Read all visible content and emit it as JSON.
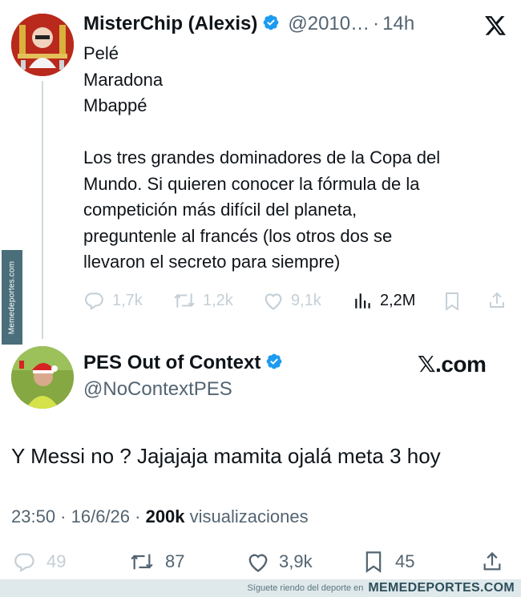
{
  "quoted_tweet": {
    "display_name": "MisterChip (Alexis)",
    "handle": "@2010…",
    "separator": "·",
    "time": "14h",
    "lines": [
      "Pelé",
      "Maradona",
      "Mbappé"
    ],
    "paragraph_lines": [
      "Los tres grandes dominadores de la Copa del",
      "Mundo. Si quieren conocer la fórmula de la",
      "competición más difícil del planeta,",
      "preguntenle al francés (los otros dos se",
      "llevaron el secreto para siempre)"
    ],
    "stats": {
      "replies": "1,7k",
      "retweets": "1,2k",
      "likes": "9,1k",
      "views": "2,2M"
    },
    "icons": [
      "verified-badge-icon",
      "x-logo-icon",
      "reply-icon",
      "retweet-icon",
      "like-icon",
      "views-icon",
      "bookmark-icon",
      "share-icon"
    ]
  },
  "reply_tweet": {
    "display_name": "PES Out of Context",
    "handle": "@NoContextPES",
    "brand": "𝕏.com",
    "text": "Y Messi no ? Jajajaja mamita ojalá meta 3 hoy",
    "timestamp": "23:50 · 16/6/26 ·",
    "views_count": "200k",
    "views_label": "visualizaciones",
    "stats": {
      "replies": "49",
      "retweets": "87",
      "likes": "3,9k",
      "bookmarks": "45"
    }
  },
  "watermarks": {
    "side": "Memedeportes.com",
    "bottom_text": "Síguete riendo del deporte en",
    "bottom_brand": "MEMEDEPORTES.COM"
  },
  "colors": {
    "text": "#0f1419",
    "muted": "#536471",
    "faint": "#c4cfd6",
    "verified": "#1d9bf0"
  }
}
